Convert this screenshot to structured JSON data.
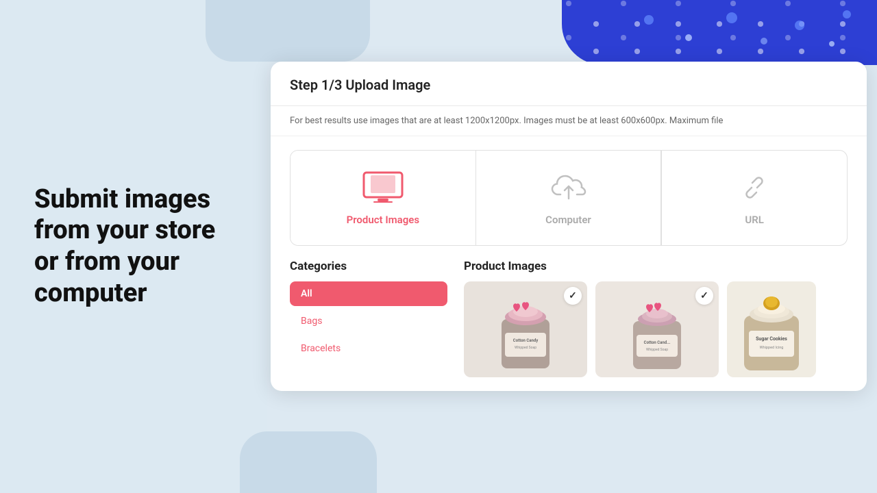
{
  "left_panel": {
    "heading_line1": "Submit images",
    "heading_line2": "from your store",
    "heading_line3": "or from your",
    "heading_line4": "computer"
  },
  "step_header": {
    "label": "Step 1/3 Upload Image"
  },
  "info_bar": {
    "text": "For best results use images that are at least 1200x1200px. Images must be at least 600x600px. Maximum file"
  },
  "upload_options": [
    {
      "label": "Product Images",
      "active": true
    },
    {
      "label": "Computer",
      "active": false
    }
  ],
  "categories": {
    "title": "Categories",
    "items": [
      {
        "label": "All",
        "active": true
      },
      {
        "label": "Bags",
        "active": false
      },
      {
        "label": "Bracelets",
        "active": false
      }
    ]
  },
  "products": {
    "title": "Product Images",
    "items": [
      {
        "name": "Cotton Candy",
        "checked": true
      },
      {
        "name": "Cotton Candy",
        "checked": true
      },
      {
        "name": "Sugar Cookies",
        "checked": false
      }
    ]
  }
}
